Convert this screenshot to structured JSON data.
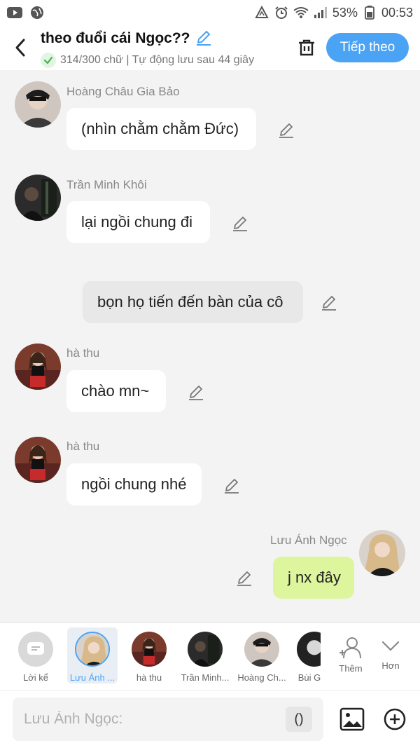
{
  "status_bar": {
    "battery": "53%",
    "time": "00:53",
    "icons": [
      "youtube-icon",
      "globe-icon",
      "data-saver-icon",
      "alarm-icon",
      "wifi-icon",
      "signal-icon",
      "battery-icon"
    ]
  },
  "header": {
    "title": "theo đuổi cái Ngọc??",
    "subtitle": "314/300 chữ | Tự động lưu sau 44 giây",
    "next_label": "Tiếp theo"
  },
  "messages": [
    {
      "type": "character",
      "name": "Hoàng Châu Gia Bảo",
      "text": "(nhìn chằm chằm Đức)"
    },
    {
      "type": "character",
      "name": "Trần Minh Khôi",
      "text": "lại ngồi chung đi"
    },
    {
      "type": "narration",
      "text": "bọn họ tiến đến bàn của cô"
    },
    {
      "type": "character",
      "name": "hà thu",
      "text": "chào mn~"
    },
    {
      "type": "character",
      "name": "hà thu",
      "text": "ngồi chung nhé"
    },
    {
      "type": "self",
      "name": "Lưu Ánh Ngọc",
      "text": "j nx đây"
    }
  ],
  "character_bar": {
    "items": [
      {
        "label": "Lời kể"
      },
      {
        "label": "Lưu Ánh ..."
      },
      {
        "label": "hà thu"
      },
      {
        "label": "Trần Minh..."
      },
      {
        "label": "Hoàng Ch..."
      },
      {
        "label": "Bùi G"
      }
    ],
    "add_label": "Thêm",
    "more_label": "Hơn"
  },
  "input": {
    "placeholder": "Lưu Ánh Ngọc:",
    "paren_label": "()"
  },
  "colors": {
    "accent": "#4ba3f5",
    "self_bubble": "#ddf59c",
    "narration_bubble": "#e8e8e8",
    "background": "#f3f3f3"
  }
}
